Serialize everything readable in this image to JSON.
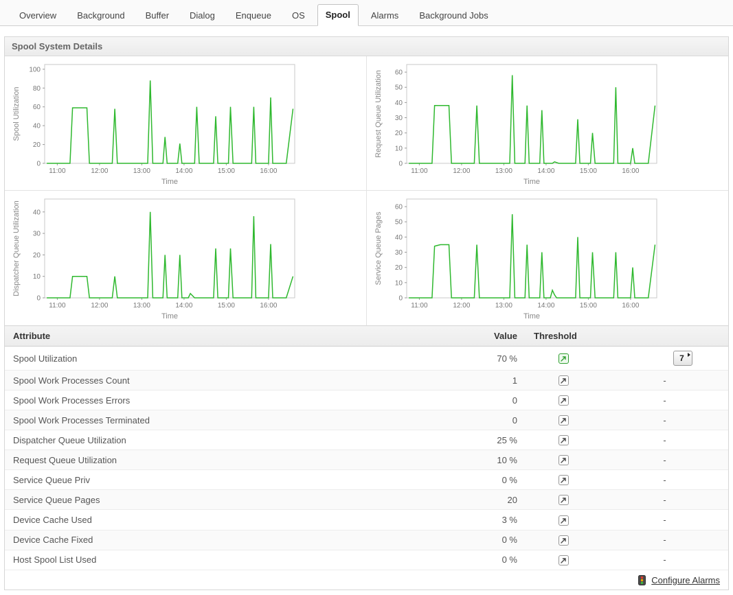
{
  "tabs": [
    {
      "label": "Overview",
      "active": false
    },
    {
      "label": "Background",
      "active": false
    },
    {
      "label": "Buffer",
      "active": false
    },
    {
      "label": "Dialog",
      "active": false
    },
    {
      "label": "Enqueue",
      "active": false
    },
    {
      "label": "OS",
      "active": false
    },
    {
      "label": "Spool",
      "active": true
    },
    {
      "label": "Alarms",
      "active": false
    },
    {
      "label": "Background Jobs",
      "active": false
    }
  ],
  "panel": {
    "title": "Spool System Details"
  },
  "colors": {
    "chart_line": "#2eb82e",
    "threshold_green": "#2e9e2e",
    "link": "#333333"
  },
  "chart_data": [
    {
      "type": "line",
      "name": "spool-utilization",
      "title": "",
      "ylabel": "Spool Utilization",
      "xlabel": "Time",
      "x_unit": "hour-of-day",
      "xlim": [
        10.7,
        16.62
      ],
      "ylim": [
        0,
        105
      ],
      "yticks": [
        0,
        20,
        40,
        60,
        80,
        100
      ],
      "xtick_values": [
        11,
        12,
        13,
        14,
        15,
        16
      ],
      "xtick_labels": [
        "11:00",
        "12:00",
        "13:00",
        "14:00",
        "15:00",
        "16:00"
      ],
      "line_color": "#2eb82e",
      "grid": false,
      "points": [
        [
          10.75,
          0
        ],
        [
          11.3,
          0
        ],
        [
          11.36,
          59
        ],
        [
          11.7,
          59
        ],
        [
          11.76,
          0
        ],
        [
          12.3,
          0
        ],
        [
          12.36,
          58
        ],
        [
          12.42,
          0
        ],
        [
          13.14,
          0
        ],
        [
          13.2,
          88
        ],
        [
          13.26,
          0
        ],
        [
          13.5,
          0
        ],
        [
          13.55,
          28
        ],
        [
          13.6,
          0
        ],
        [
          13.85,
          0
        ],
        [
          13.9,
          21
        ],
        [
          13.95,
          0
        ],
        [
          14.25,
          0
        ],
        [
          14.3,
          60
        ],
        [
          14.36,
          0
        ],
        [
          14.7,
          0
        ],
        [
          14.75,
          50
        ],
        [
          14.8,
          0
        ],
        [
          15.05,
          0
        ],
        [
          15.1,
          60
        ],
        [
          15.16,
          0
        ],
        [
          15.6,
          0
        ],
        [
          15.65,
          60
        ],
        [
          15.7,
          0
        ],
        [
          16.0,
          0
        ],
        [
          16.05,
          70
        ],
        [
          16.1,
          0
        ],
        [
          16.42,
          0
        ],
        [
          16.58,
          58
        ]
      ]
    },
    {
      "type": "line",
      "name": "request-queue-utilization",
      "title": "",
      "ylabel": "Request Queue Utilization",
      "xlabel": "Time",
      "x_unit": "hour-of-day",
      "xlim": [
        10.7,
        16.62
      ],
      "ylim": [
        0,
        65
      ],
      "yticks": [
        0,
        10,
        20,
        30,
        40,
        50,
        60
      ],
      "xtick_values": [
        11,
        12,
        13,
        14,
        15,
        16
      ],
      "xtick_labels": [
        "11:00",
        "12:00",
        "13:00",
        "14:00",
        "15:00",
        "16:00"
      ],
      "line_color": "#2eb82e",
      "grid": false,
      "points": [
        [
          10.75,
          0
        ],
        [
          11.3,
          0
        ],
        [
          11.36,
          38
        ],
        [
          11.7,
          38
        ],
        [
          11.76,
          0
        ],
        [
          12.3,
          0
        ],
        [
          12.36,
          38
        ],
        [
          12.42,
          0
        ],
        [
          13.14,
          0
        ],
        [
          13.2,
          58
        ],
        [
          13.26,
          0
        ],
        [
          13.5,
          0
        ],
        [
          13.55,
          38
        ],
        [
          13.6,
          0
        ],
        [
          13.85,
          0
        ],
        [
          13.9,
          35
        ],
        [
          13.95,
          0
        ],
        [
          14.15,
          0
        ],
        [
          14.2,
          1
        ],
        [
          14.3,
          0
        ],
        [
          14.7,
          0
        ],
        [
          14.75,
          29
        ],
        [
          14.8,
          0
        ],
        [
          15.05,
          0
        ],
        [
          15.1,
          20
        ],
        [
          15.16,
          0
        ],
        [
          15.6,
          0
        ],
        [
          15.65,
          50
        ],
        [
          15.7,
          0
        ],
        [
          16.0,
          0
        ],
        [
          16.05,
          10
        ],
        [
          16.1,
          0
        ],
        [
          16.42,
          0
        ],
        [
          16.58,
          38
        ]
      ]
    },
    {
      "type": "line",
      "name": "dispatcher-queue-utilization",
      "title": "",
      "ylabel": "Dispatcher Queue Utilization",
      "xlabel": "Time",
      "x_unit": "hour-of-day",
      "xlim": [
        10.7,
        16.62
      ],
      "ylim": [
        0,
        46
      ],
      "yticks": [
        0,
        10,
        20,
        30,
        40
      ],
      "xtick_values": [
        11,
        12,
        13,
        14,
        15,
        16
      ],
      "xtick_labels": [
        "11:00",
        "12:00",
        "13:00",
        "14:00",
        "15:00",
        "16:00"
      ],
      "line_color": "#2eb82e",
      "grid": false,
      "points": [
        [
          10.75,
          0
        ],
        [
          11.3,
          0
        ],
        [
          11.36,
          10
        ],
        [
          11.7,
          10
        ],
        [
          11.76,
          0
        ],
        [
          12.3,
          0
        ],
        [
          12.36,
          10
        ],
        [
          12.42,
          0
        ],
        [
          13.14,
          0
        ],
        [
          13.2,
          40
        ],
        [
          13.26,
          0
        ],
        [
          13.5,
          0
        ],
        [
          13.55,
          20
        ],
        [
          13.6,
          0
        ],
        [
          13.85,
          0
        ],
        [
          13.9,
          20
        ],
        [
          13.95,
          0
        ],
        [
          14.1,
          0
        ],
        [
          14.15,
          2
        ],
        [
          14.25,
          0
        ],
        [
          14.7,
          0
        ],
        [
          14.75,
          23
        ],
        [
          14.8,
          0
        ],
        [
          15.05,
          0
        ],
        [
          15.1,
          23
        ],
        [
          15.16,
          0
        ],
        [
          15.6,
          0
        ],
        [
          15.65,
          38
        ],
        [
          15.7,
          0
        ],
        [
          16.0,
          0
        ],
        [
          16.05,
          25
        ],
        [
          16.1,
          0
        ],
        [
          16.42,
          0
        ],
        [
          16.58,
          10
        ]
      ]
    },
    {
      "type": "line",
      "name": "service-queue-pages",
      "title": "",
      "ylabel": "Service Queue Pages",
      "xlabel": "Time",
      "x_unit": "hour-of-day",
      "xlim": [
        10.7,
        16.62
      ],
      "ylim": [
        0,
        65
      ],
      "yticks": [
        0,
        10,
        20,
        30,
        40,
        50,
        60
      ],
      "xtick_values": [
        11,
        12,
        13,
        14,
        15,
        16
      ],
      "xtick_labels": [
        "11:00",
        "12:00",
        "13:00",
        "14:00",
        "15:00",
        "16:00"
      ],
      "line_color": "#2eb82e",
      "grid": false,
      "points": [
        [
          10.75,
          0
        ],
        [
          11.3,
          0
        ],
        [
          11.36,
          34
        ],
        [
          11.5,
          35
        ],
        [
          11.7,
          35
        ],
        [
          11.76,
          0
        ],
        [
          12.3,
          0
        ],
        [
          12.36,
          35
        ],
        [
          12.42,
          0
        ],
        [
          13.14,
          0
        ],
        [
          13.2,
          55
        ],
        [
          13.26,
          0
        ],
        [
          13.5,
          0
        ],
        [
          13.55,
          35
        ],
        [
          13.6,
          0
        ],
        [
          13.85,
          0
        ],
        [
          13.9,
          30
        ],
        [
          13.95,
          0
        ],
        [
          14.1,
          0
        ],
        [
          14.15,
          5
        ],
        [
          14.2,
          2
        ],
        [
          14.25,
          0
        ],
        [
          14.7,
          0
        ],
        [
          14.75,
          40
        ],
        [
          14.8,
          0
        ],
        [
          15.05,
          0
        ],
        [
          15.1,
          30
        ],
        [
          15.16,
          0
        ],
        [
          15.6,
          0
        ],
        [
          15.65,
          30
        ],
        [
          15.7,
          0
        ],
        [
          16.0,
          0
        ],
        [
          16.05,
          20
        ],
        [
          16.1,
          0
        ],
        [
          16.42,
          0
        ],
        [
          16.58,
          35
        ]
      ]
    }
  ],
  "table": {
    "headers": [
      "Attribute",
      "Value",
      "Threshold",
      ""
    ],
    "rows": [
      {
        "attribute": "Spool Utilization",
        "value": "70 %",
        "icon": "green",
        "button": "7"
      },
      {
        "attribute": "Spool Work Processes Count",
        "value": "1",
        "icon": "normal",
        "extra": "-"
      },
      {
        "attribute": "Spool Work Processes Errors",
        "value": "0",
        "icon": "normal",
        "extra": "-"
      },
      {
        "attribute": "Spool Work Processes Terminated",
        "value": "0",
        "icon": "normal",
        "extra": "-"
      },
      {
        "attribute": "Dispatcher Queue Utilization",
        "value": "25 %",
        "icon": "normal",
        "extra": "-"
      },
      {
        "attribute": "Request Queue Utilization",
        "value": "10 %",
        "icon": "normal",
        "extra": "-"
      },
      {
        "attribute": "Service Queue Priv",
        "value": "0 %",
        "icon": "normal",
        "extra": "-"
      },
      {
        "attribute": "Service Queue Pages",
        "value": "20",
        "icon": "normal",
        "extra": "-"
      },
      {
        "attribute": "Device Cache Used",
        "value": "3 %",
        "icon": "normal",
        "extra": "-"
      },
      {
        "attribute": "Device Cache Fixed",
        "value": "0 %",
        "icon": "normal",
        "extra": "-"
      },
      {
        "attribute": "Host Spool List Used",
        "value": "0 %",
        "icon": "normal",
        "extra": "-"
      }
    ]
  },
  "footer": {
    "configure_alarms": "Configure Alarms"
  }
}
